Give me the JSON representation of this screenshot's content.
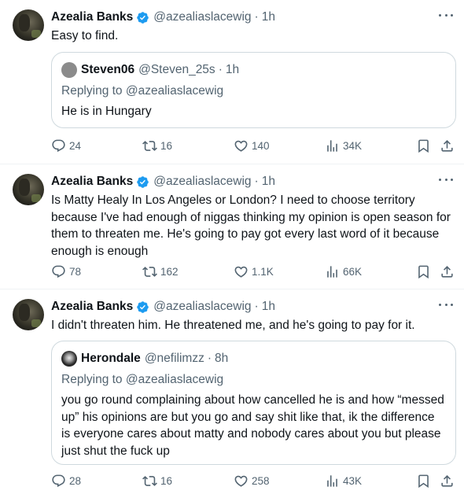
{
  "tweets": [
    {
      "author": "Azealia Banks",
      "handle": "@azealiaslacewig",
      "time": "1h",
      "text": "Easy to find.",
      "quote": {
        "author": "Steven06",
        "handle": "@Steven_25s",
        "time": "1h",
        "replying": "Replying to @azealiaslacewig",
        "text": "He is in Hungary"
      },
      "replies": "24",
      "retweets": "16",
      "likes": "140",
      "views": "34K"
    },
    {
      "author": "Azealia Banks",
      "handle": "@azealiaslacewig",
      "time": "1h",
      "text": "Is Matty Healy In Los Angeles or London? I need to choose territory because I've had enough of niggas thinking my opinion is open season for them to threaten me. He's going to pay got every last word of it because enough is enough",
      "replies": "78",
      "retweets": "162",
      "likes": "1.1K",
      "views": "66K"
    },
    {
      "author": "Azealia Banks",
      "handle": "@azealiaslacewig",
      "time": "1h",
      "text": "I didn't threaten him. He threatened me, and he's going to pay for it.",
      "quote": {
        "author": "Herondale",
        "handle": "@nefilimzz",
        "time": "8h",
        "replying": "Replying to @azealiaslacewig",
        "text": "you go round complaining about how cancelled he is and how “messed up” his opinions are but you go and say shit like that, ik the difference is everyone cares about matty and nobody cares about you but please just shut the fuck up"
      },
      "replies": "28",
      "retweets": "16",
      "likes": "258",
      "views": "43K"
    }
  ],
  "sep": "·",
  "colors": {
    "text": "#0f1419",
    "secondary": "#536471",
    "verified": "#1d9bf0",
    "border": "#cfd9de"
  },
  "icons": [
    "verified-badge-icon",
    "more-options-icon",
    "reply-icon",
    "retweet-icon",
    "like-icon",
    "views-icon",
    "bookmark-icon",
    "share-icon"
  ]
}
